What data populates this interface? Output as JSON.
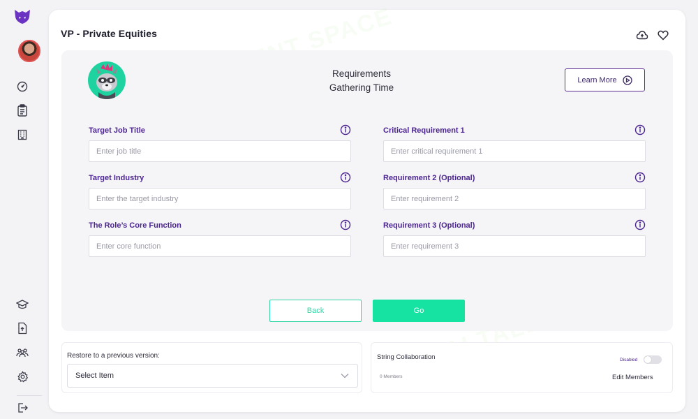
{
  "page": {
    "title": "VP - Private Equities"
  },
  "panel": {
    "heading_line1": "Requirements",
    "heading_line2": "Gathering Time",
    "learn_more_label": "Learn More"
  },
  "form": {
    "fields": [
      {
        "label": "Target Job Title",
        "placeholder": "Enter job title"
      },
      {
        "label": "Target Industry",
        "placeholder": "Enter the target industry"
      },
      {
        "label": "The Role’s Core Function",
        "placeholder": "Enter core function"
      },
      {
        "label": "Critical Requirement 1",
        "placeholder": "Enter critical requirement 1"
      },
      {
        "label": "Requirement 2 (Optional)",
        "placeholder": "Enter requirement 2"
      },
      {
        "label": "Requirement 3 (Optional)",
        "placeholder": "Enter requirement 3"
      }
    ],
    "back_label": "Back",
    "go_label": "Go"
  },
  "restore": {
    "label": "Restore to a previous version:",
    "selected": "Select Item"
  },
  "collaboration": {
    "title": "String Collaboration",
    "members": "0 Members",
    "toggle_label": "Disabled",
    "edit_label": "Edit Members"
  },
  "watermark": "AI TALENT SPACE",
  "colors": {
    "brand_purple": "#4b2590",
    "accent_green": "#16e3a2",
    "panel_bg": "#f5f5f8"
  },
  "icons": {
    "logo": "fox-logo-icon",
    "nav": [
      "dashboard-gauge-icon",
      "clipboard-icon",
      "building-icon",
      "graduation-cap-icon",
      "document-upload-icon",
      "team-icon",
      "settings-gear-icon",
      "logout-icon"
    ],
    "top": [
      "cloud-icon",
      "heart-icon"
    ]
  }
}
